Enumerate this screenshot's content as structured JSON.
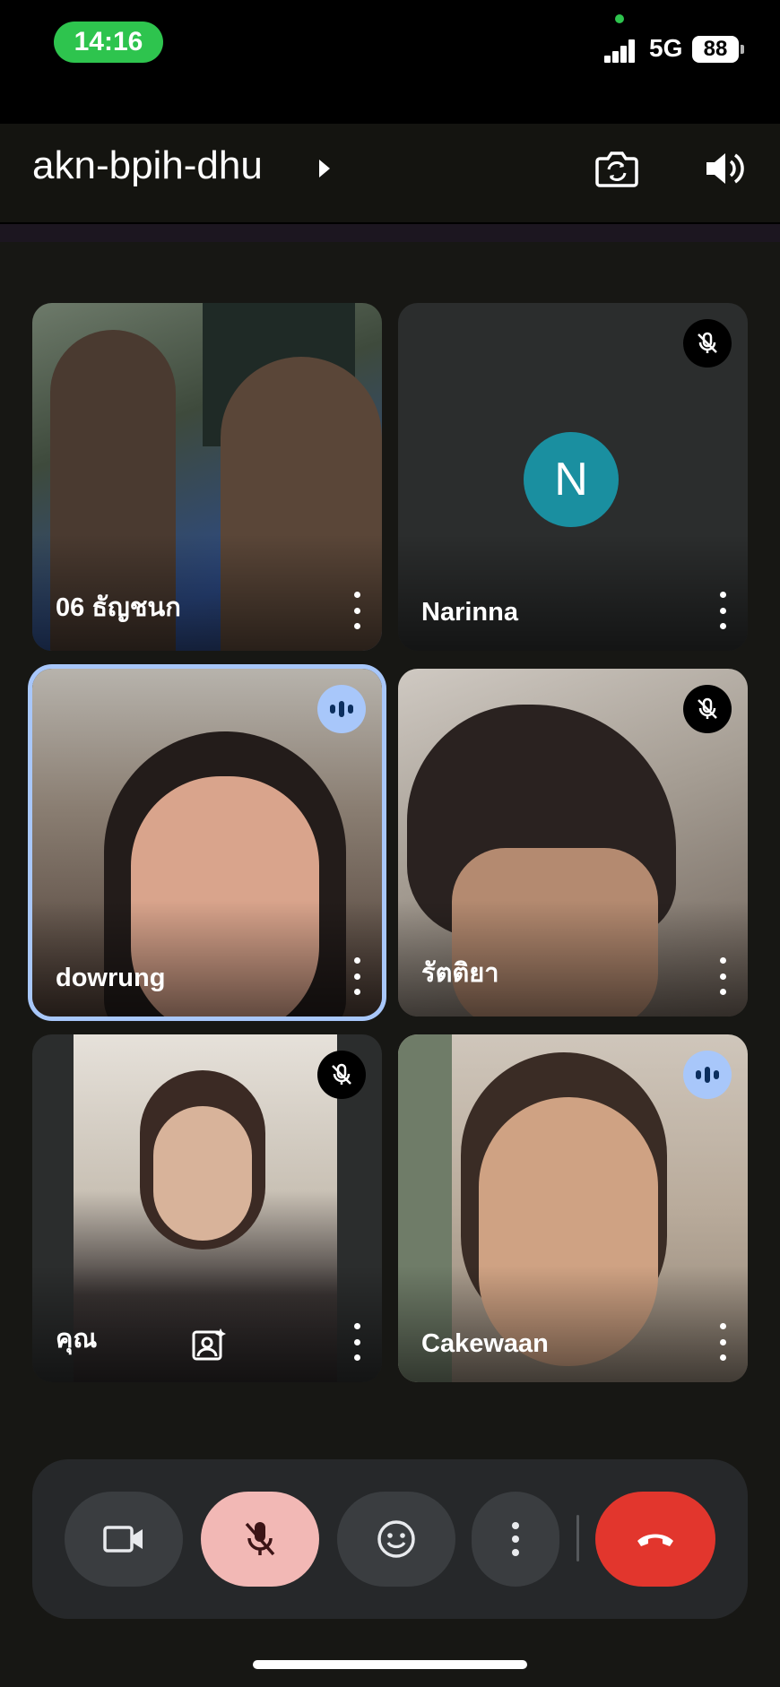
{
  "status_bar": {
    "time": "14:16",
    "network": "5G",
    "battery": "88"
  },
  "header": {
    "meeting_code": "akn-bpih-dhu",
    "icons": [
      "camera-switch-icon",
      "speaker-icon"
    ]
  },
  "participants": [
    {
      "name": "06 ธัญชนก",
      "state": "video"
    },
    {
      "name": "Narinna",
      "state": "muted",
      "avatar_letter": "N",
      "avatar_color": "#1a8fa0"
    },
    {
      "name": "dowrung",
      "state": "speaking",
      "highlighted": true
    },
    {
      "name": "รัตติยา",
      "state": "muted"
    },
    {
      "name": "คุณ",
      "state": "muted",
      "is_self": true
    },
    {
      "name": "Cakewaan",
      "state": "speaking"
    }
  ],
  "controls": {
    "camera": "camera-icon",
    "mic": "mic-off-icon",
    "reactions": "emoji-icon",
    "more": "more-vert-icon",
    "leave": "hang-up-icon"
  },
  "colors": {
    "accent_blue": "#a8c7fa",
    "mic_off_bg": "#f2b8b5",
    "hangup_red": "#e2362d",
    "time_pill_green": "#2ec44e"
  }
}
